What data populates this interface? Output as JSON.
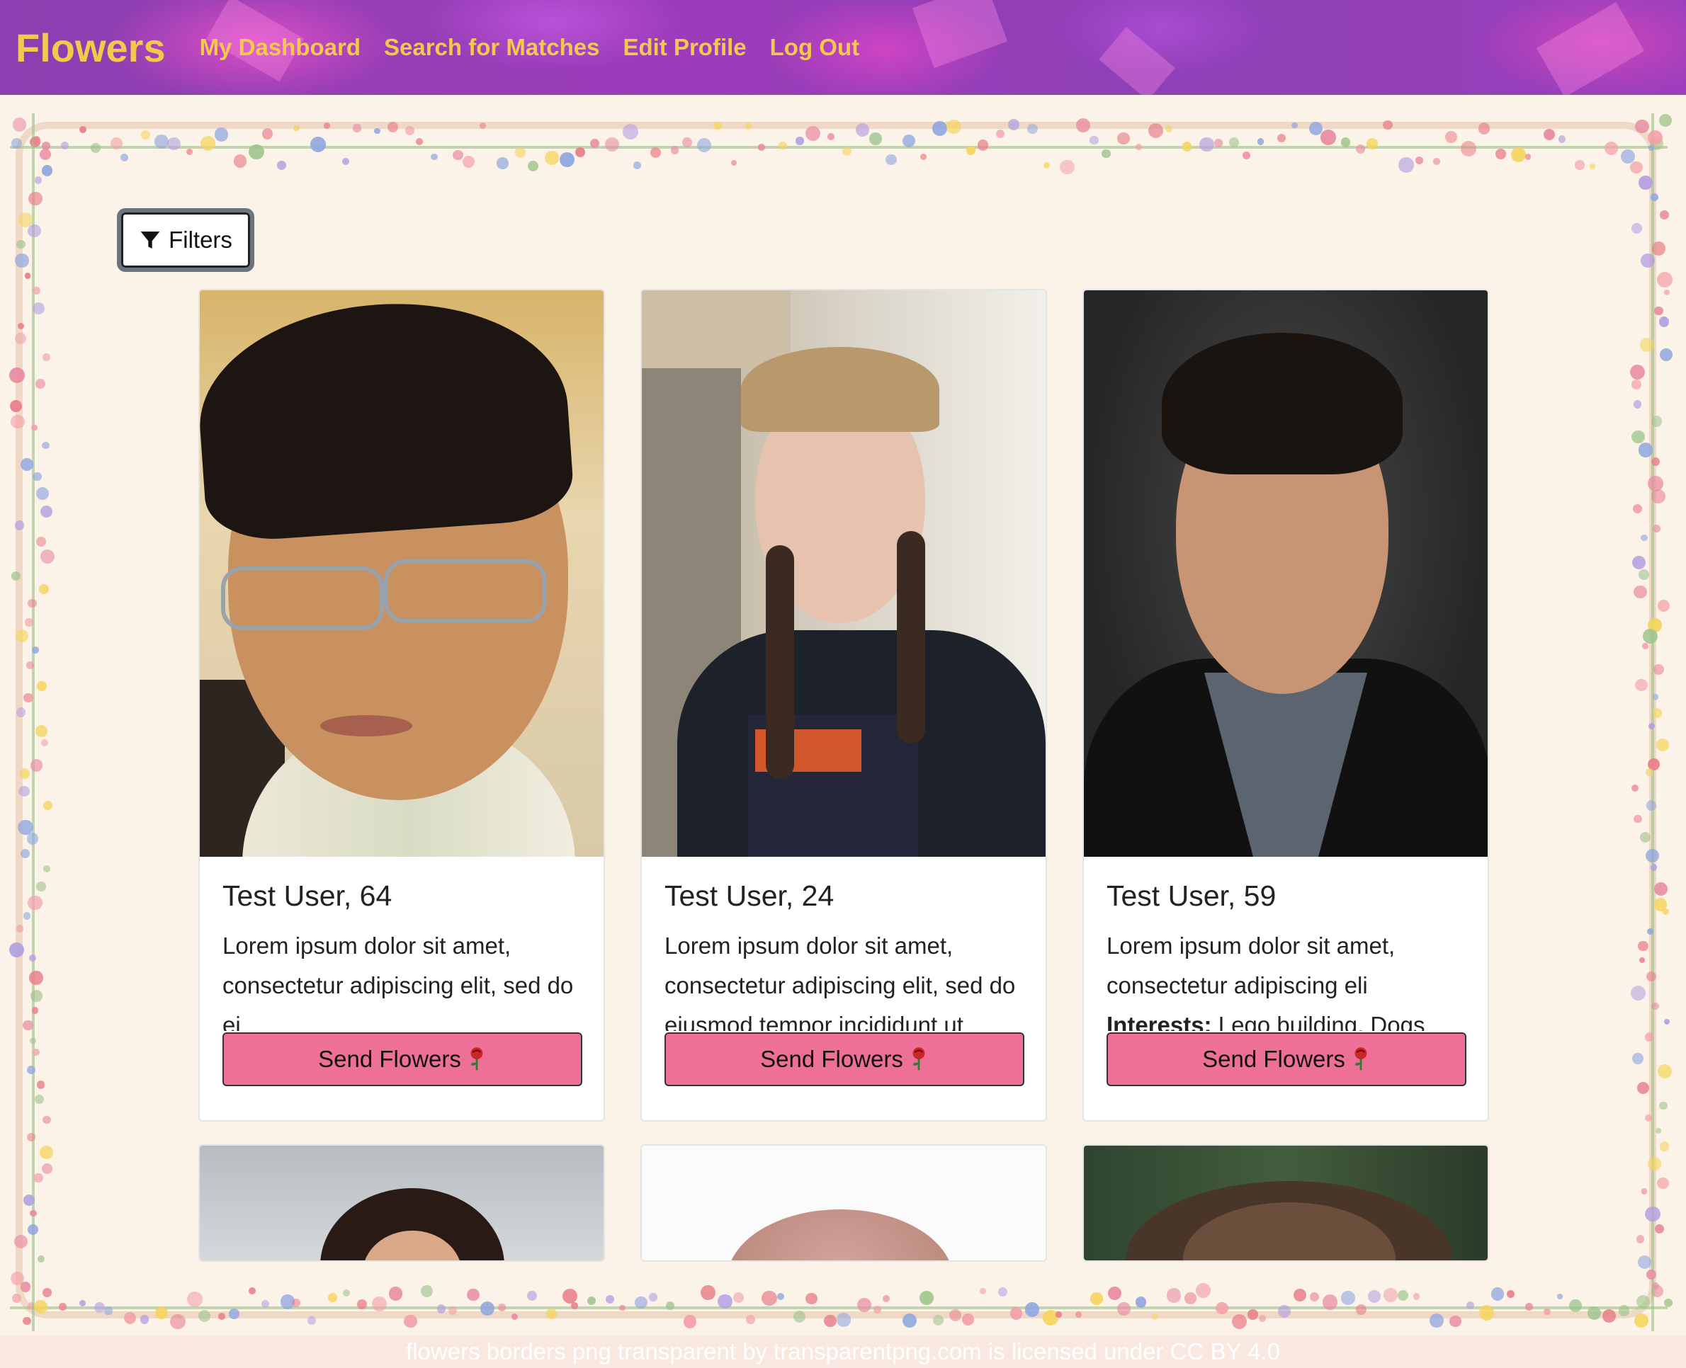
{
  "nav": {
    "brand": "Flowers",
    "links": [
      "My Dashboard",
      "Search for Matches",
      "Edit Profile",
      "Log Out"
    ]
  },
  "filters": {
    "label": "Filters",
    "icon": "filter-funnel-icon"
  },
  "cards": [
    {
      "title": "Test User, 64",
      "text": "Lorem ipsum dolor sit amet, consectetur adipiscing elit, sed do ei",
      "button": "Send Flowers"
    },
    {
      "title": "Test User, 24",
      "text": "Lorem ipsum dolor sit amet, consectetur adipiscing elit, sed do eiusmod tempor incididunt ut",
      "button": "Send Flowers"
    },
    {
      "title": "Test User, 59",
      "text": "Lorem ipsum dolor sit amet, consectetur adipiscing eli",
      "interests_label": "Interests:",
      "interests": "Lego building, Dogs",
      "button": "Send Flowers"
    }
  ],
  "footer": {
    "credit": "flowers borders png transparent by transparentpng.com is licensed under CC BY 4.0"
  },
  "colors": {
    "nav_purple": "#9b3fbc",
    "nav_link": "#f2c94c",
    "button_pink": "#ee7097",
    "page_bg": "#fbf2e8"
  }
}
